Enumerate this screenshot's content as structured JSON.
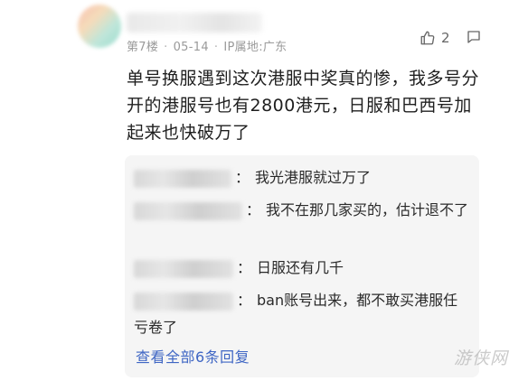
{
  "comment": {
    "meta": {
      "floor": "第7楼",
      "date": "05-14",
      "ip_location": "IP属地:广东"
    },
    "like_count": "2",
    "body": "单号换服遇到这次港服中奖真的惨，我多号分开的港服号也有2800港元，日服和巴西号加起来也快破万了"
  },
  "replies": {
    "items": [
      {
        "colon": "：",
        "text": "我光港服就过万了"
      },
      {
        "colon": "：",
        "text": "我不在那几家买的，估计退不了"
      },
      {
        "colon": "：",
        "text": "日服还有几千"
      },
      {
        "colon": "：",
        "text": "ban账号出来，都不敢买港服任亏卷了"
      }
    ],
    "view_all_label": "查看全部6条回复"
  },
  "watermark": "游侠网",
  "colors": {
    "link": "#3f66c4",
    "reply_bg": "#f5f5f5",
    "meta_text": "#9a9a9a"
  }
}
